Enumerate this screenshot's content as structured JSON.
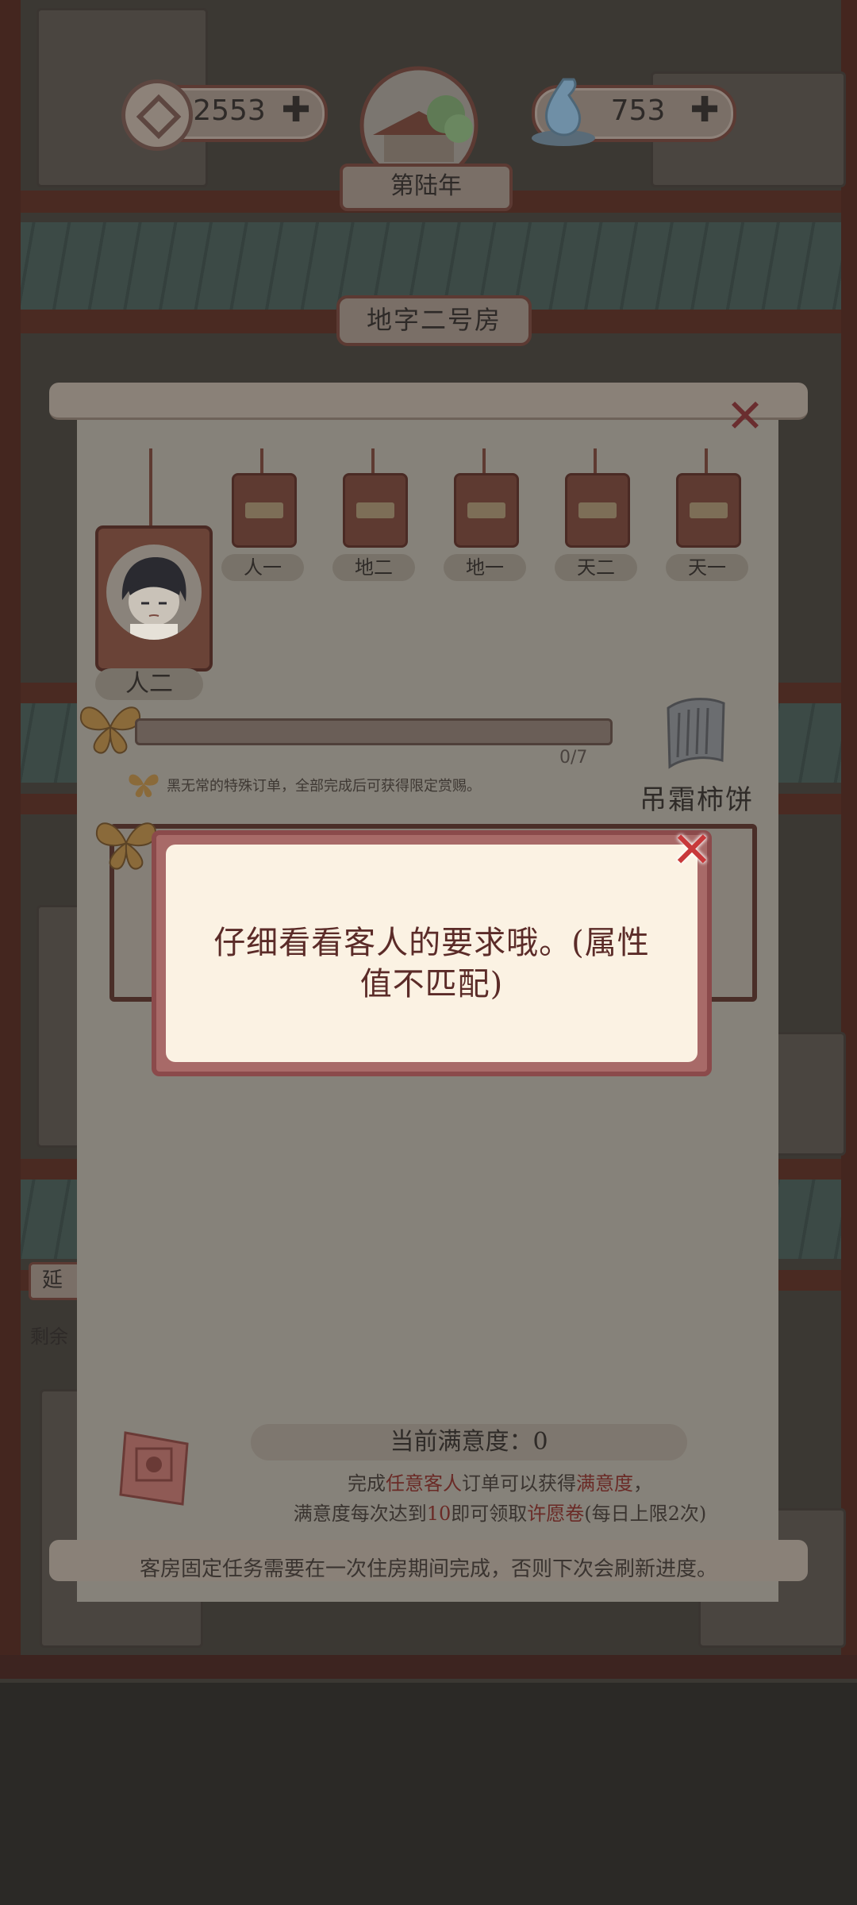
{
  "resources": {
    "coins": "2553",
    "jade": "753",
    "add_symbol": "✚"
  },
  "year_label": "第陆年",
  "room_name": "地字二号房",
  "panel": {
    "close_symbol": "✕",
    "current_guest_tag": "人二",
    "guest_tags": [
      "人一",
      "地二",
      "地一",
      "天二",
      "天一"
    ],
    "progress_text": "0/7",
    "progress_fraction": 0,
    "note": "黑无常的特殊订单，全部完成后可获得限定赏赐。",
    "reward_name": "吊霜柿饼",
    "satisfaction_label": "当前满意度：0",
    "satisfaction_desc": {
      "l1_a": "完成",
      "l1_b": "任意客人",
      "l1_c": "订单可以获得",
      "l1_d": "满意度",
      "l1_e": "，",
      "l2_a": "满意度每次达到",
      "l2_b": "10",
      "l2_c": "即可领取",
      "l2_d": "许愿卷",
      "l2_e": "(每日上限2次)"
    },
    "footer_note": "客房固定任务需要在一次住房期间完成，否则下次会刷新进度。"
  },
  "side": {
    "sign": "延",
    "text": "剩余"
  },
  "dialog": {
    "message": "仔细看看客人的要求哦。(属性值不匹配)",
    "close_symbol": "✕"
  },
  "colors": {
    "dialog_border": "#a86a68",
    "dialog_bg": "#fbf2e3",
    "dialog_text": "#5b2b28",
    "highlight": "#6a2a26",
    "close_red": "#c8393b"
  }
}
